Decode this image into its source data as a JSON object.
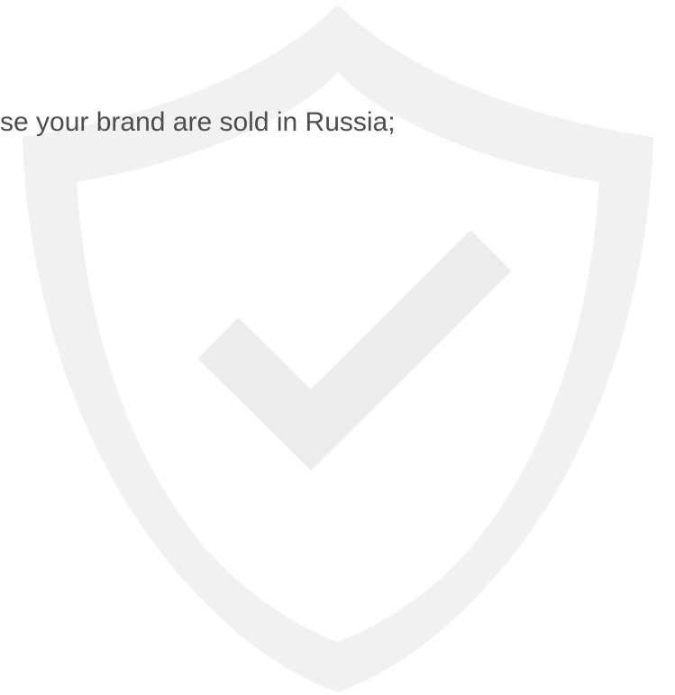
{
  "content": {
    "line_text": "se your brand are sold in Russia;"
  },
  "watermark": {
    "icon": "shield-check-icon",
    "color": "#f1f1f1",
    "check_color": "#ececec"
  },
  "colors": {
    "text": "#4d4d4d",
    "background": "#ffffff"
  }
}
